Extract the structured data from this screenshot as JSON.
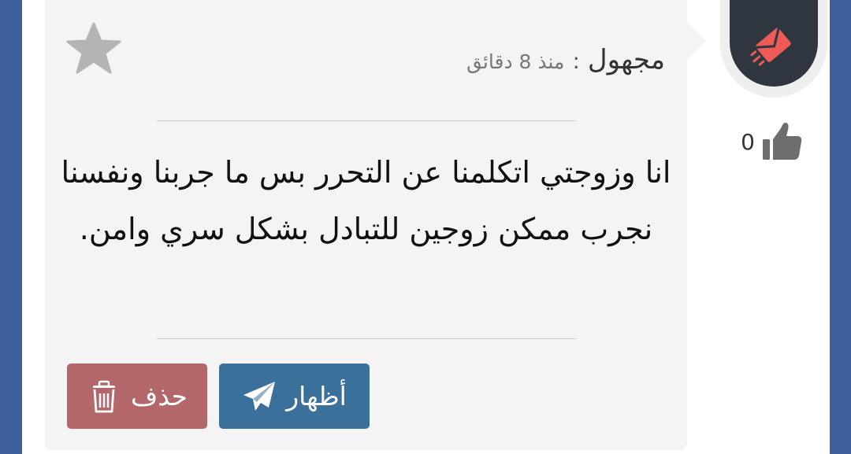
{
  "post": {
    "author": "مجهول",
    "separator": ":",
    "time": "منذ 8 دقائق",
    "message": "انا وزوجتي اتكلمنا عن التحرر بس ما جربنا ونفسنا نجرب ممكن زوجين للتبادل بشكل سري وامن.",
    "likes": "0"
  },
  "actions": {
    "show_label": "أظهار",
    "delete_label": "حذف"
  },
  "colors": {
    "background": "#3e5f9b",
    "card": "#f4f4f4",
    "show_button": "#3a7099",
    "delete_button": "#b3676a",
    "avatar": "#2f3640",
    "avatar_accent": "#ef5a57"
  },
  "icons": {
    "avatar": "envelope-rocket-icon",
    "like": "thumbs-up-icon",
    "favorite": "star-icon",
    "show": "paper-plane-icon",
    "delete": "trash-icon"
  }
}
